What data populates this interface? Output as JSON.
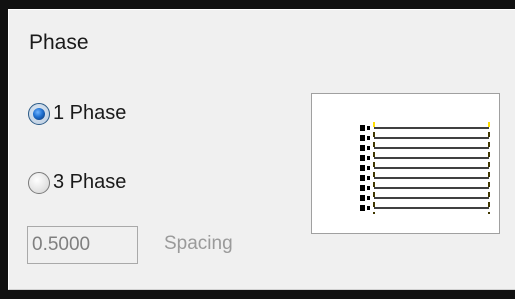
{
  "phase_group": {
    "title": "Phase",
    "options": [
      {
        "label": "1 Phase",
        "checked": true
      },
      {
        "label": "3 Phase",
        "checked": false
      }
    ]
  },
  "spacing": {
    "value": "0.5000",
    "label": "Spacing",
    "enabled": false
  },
  "preview": {
    "icon": "conductor-lines-diagram",
    "line_count": 9,
    "line_color": "#000000",
    "end_mark_color": "#ffdd00"
  }
}
